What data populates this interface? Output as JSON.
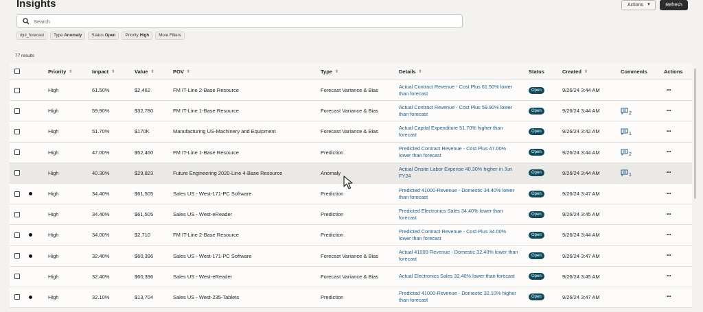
{
  "header": {
    "title": "Insights",
    "actions_label": "Actions",
    "refresh_label": "Refresh"
  },
  "search": {
    "placeholder": "Search",
    "icon": "search-icon"
  },
  "filters": [
    {
      "text": "#jul_forecast",
      "bold": ""
    },
    {
      "text": "Type ",
      "bold": "Anomaly"
    },
    {
      "text": "Status ",
      "bold": "Open"
    },
    {
      "text": "Priority ",
      "bold": "High"
    },
    {
      "text": "More Filters",
      "bold": ""
    }
  ],
  "results_count": "77 results",
  "columns": [
    "Priority",
    "Impact",
    "Value",
    "POV",
    "Type",
    "Details",
    "Status",
    "Created",
    "Comments",
    "Actions"
  ],
  "rows": [
    {
      "dot": false,
      "priority": "High",
      "impact": "61.50%",
      "value": "$2,462",
      "pov": "FM IT-Line 2-Base Resource",
      "type": "Forecast Variance & Bias",
      "details": "Actual Contract Revenue - Cost Plus 61.50% lower than forecast",
      "status": "Open",
      "created": "9/26/24 3:44 AM",
      "comments": ""
    },
    {
      "dot": false,
      "priority": "High",
      "impact": "59.90%",
      "value": "$32,780",
      "pov": "FM IT-Line 1-Base Resource",
      "type": "Forecast Variance & Bias",
      "details": "Actual Contract Revenue - Cost Plus 59.90% lower than forecast",
      "status": "Open",
      "created": "9/26/24 3:44 AM",
      "comments": "2"
    },
    {
      "dot": false,
      "priority": "High",
      "impact": "51.70%",
      "value": "$170K",
      "pov": "Manufacturing US-Machinery and Equipment",
      "type": "Forecast Variance & Bias",
      "details": "Actual Capital Expenditure 51.70% higher than forecast",
      "status": "Open",
      "created": "9/26/24 3:42 AM",
      "comments": "1"
    },
    {
      "dot": false,
      "priority": "High",
      "impact": "47.00%",
      "value": "$52,460",
      "pov": "FM IT-Line 1-Base Resource",
      "type": "Prediction",
      "details": "Predicted Contract Revenue - Cost Plus 47.00% lower than forecast",
      "status": "Open",
      "created": "9/26/24 3:44 AM",
      "comments": "2"
    },
    {
      "dot": false,
      "priority": "High",
      "impact": "40.30%",
      "value": "$29,823",
      "pov": "Future Engineering 2020-Line 4-Base Resource",
      "type": "Anomaly",
      "details": "Actual Onsite Labor Expense 40.30% higher in Jun FY24",
      "status": "Open",
      "created": "9/26/24 3:44 AM",
      "comments": "1"
    },
    {
      "dot": true,
      "priority": "High",
      "impact": "34.40%",
      "value": "$61,505",
      "pov": "Sales US - West-171-PC Software",
      "type": "Prediction",
      "details": "Predicted 41000-Revenue - Domestic 34.40% lower than forecast",
      "status": "Open",
      "created": "9/26/24 3:47 AM",
      "comments": ""
    },
    {
      "dot": false,
      "priority": "High",
      "impact": "34.40%",
      "value": "$61,505",
      "pov": "Sales US - West-eReader",
      "type": "Prediction",
      "details": "Predicted Electronics Sales 34.40% lower than forecast",
      "status": "Open",
      "created": "9/26/24 3:45 AM",
      "comments": ""
    },
    {
      "dot": true,
      "priority": "High",
      "impact": "34.00%",
      "value": "$2,710",
      "pov": "FM IT-Line 2-Base Resource",
      "type": "Prediction",
      "details": "Predicted Contract Revenue - Cost Plus 34.00% lower than forecast",
      "status": "Open",
      "created": "9/26/24 3:44 AM",
      "comments": ""
    },
    {
      "dot": true,
      "priority": "High",
      "impact": "32.40%",
      "value": "$60,396",
      "pov": "Sales US - West-171-PC Software",
      "type": "Forecast Variance & Bias",
      "details": "Actual 41000-Revenue - Domestic 32.40% lower than forecast",
      "status": "Open",
      "created": "9/26/24 3:47 AM",
      "comments": ""
    },
    {
      "dot": false,
      "priority": "High",
      "impact": "32.40%",
      "value": "$60,396",
      "pov": "Sales US - West-eReader",
      "type": "Forecast Variance & Bias",
      "details": "Actual Electronics Sales 32.40% lower than forecast",
      "status": "Open",
      "created": "9/26/24 3:45 AM",
      "comments": ""
    },
    {
      "dot": true,
      "priority": "High",
      "impact": "32.10%",
      "value": "$13,704",
      "pov": "Sales US - West-235-Tablets",
      "type": "Prediction",
      "details": "Predicted 41000-Revenue - Domestic 32.10% higher than forecast",
      "status": "Open",
      "created": "9/26/24 3:47 AM",
      "comments": ""
    }
  ],
  "colors": {
    "link": "#1f5c8a",
    "status_badge": "#0f4b5c",
    "refresh_button": "#2d2d2d"
  }
}
